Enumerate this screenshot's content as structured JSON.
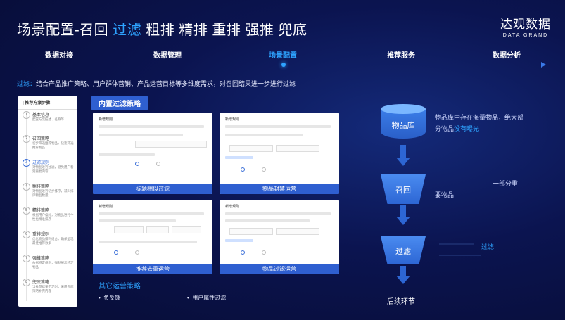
{
  "title": {
    "prefix": "场景配置-召回 ",
    "highlight": "过滤",
    "suffix": " 粗排 精排 重排 强推 兜底"
  },
  "logo": {
    "cn": "达观数据",
    "en": "DATA GRAND"
  },
  "nav": {
    "items": [
      "数据对接",
      "数据管理",
      "场景配置",
      "推荐服务",
      "数据分析"
    ],
    "active": "场景配置"
  },
  "desc": {
    "label": "过滤：",
    "text": "结合产品推广策略、用户群体营销、产品运营目标等多维度需求，对召回结果进一步进行过滤"
  },
  "steps": {
    "header": "| 推荐方案步骤",
    "items": [
      {
        "num": "1",
        "title": "基本信息",
        "desc": "配置方案描述、名称等"
      },
      {
        "num": "2",
        "title": "召回策略",
        "desc": "初步筛选推荐物品，快速筛选推荐物品"
      },
      {
        "num": "3",
        "title": "过滤规则",
        "desc": "对物品进行过滤，避免用户看到重复内容"
      },
      {
        "num": "4",
        "title": "粗排策略",
        "desc": "对物品进行初步排序，减少排序物品数量"
      },
      {
        "num": "5",
        "title": "精排策略",
        "desc": "根据用户偏好，对物品进行个性化精准排序"
      },
      {
        "num": "6",
        "title": "重排规则",
        "desc": "优化物品排列组合，确保呈现最佳推荐效果"
      },
      {
        "num": "7",
        "title": "强推策略",
        "desc": "依据特定规则，强制展示特定物品"
      },
      {
        "num": "8",
        "title": "兜底策略",
        "desc": "当推荐结果不足时，采用兜底策略补充内容"
      }
    ],
    "active": "3"
  },
  "builtin_tag": "内置过滤策略",
  "cards": [
    {
      "caption": "标题相似过滤",
      "label": "新增规则"
    },
    {
      "caption": "物品封禁运营",
      "label": "新增规则"
    },
    {
      "caption": "推荐去重运营",
      "label": "新增规则"
    },
    {
      "caption": "物品过滤运营",
      "label": "新增规则"
    }
  ],
  "other": {
    "title": "其它运营策略",
    "items": [
      "负反馈",
      "用户属性过滤"
    ]
  },
  "funnel": {
    "db_label": "物品库",
    "db_text_1": "物品库中存在海量物品，绝大部",
    "db_text_2a": "分物品",
    "db_text_2b": "没有曝光",
    "recall_label": "召回",
    "recall_text_a": "一部分重",
    "recall_text_b": "要物品",
    "filter_label": "过滤",
    "filter_text": "过滤",
    "final_label": "后续环节"
  },
  "colors": {
    "accent": "#2ea3ff",
    "primary": "#2f5fd0",
    "background": "#0a0f3a"
  }
}
